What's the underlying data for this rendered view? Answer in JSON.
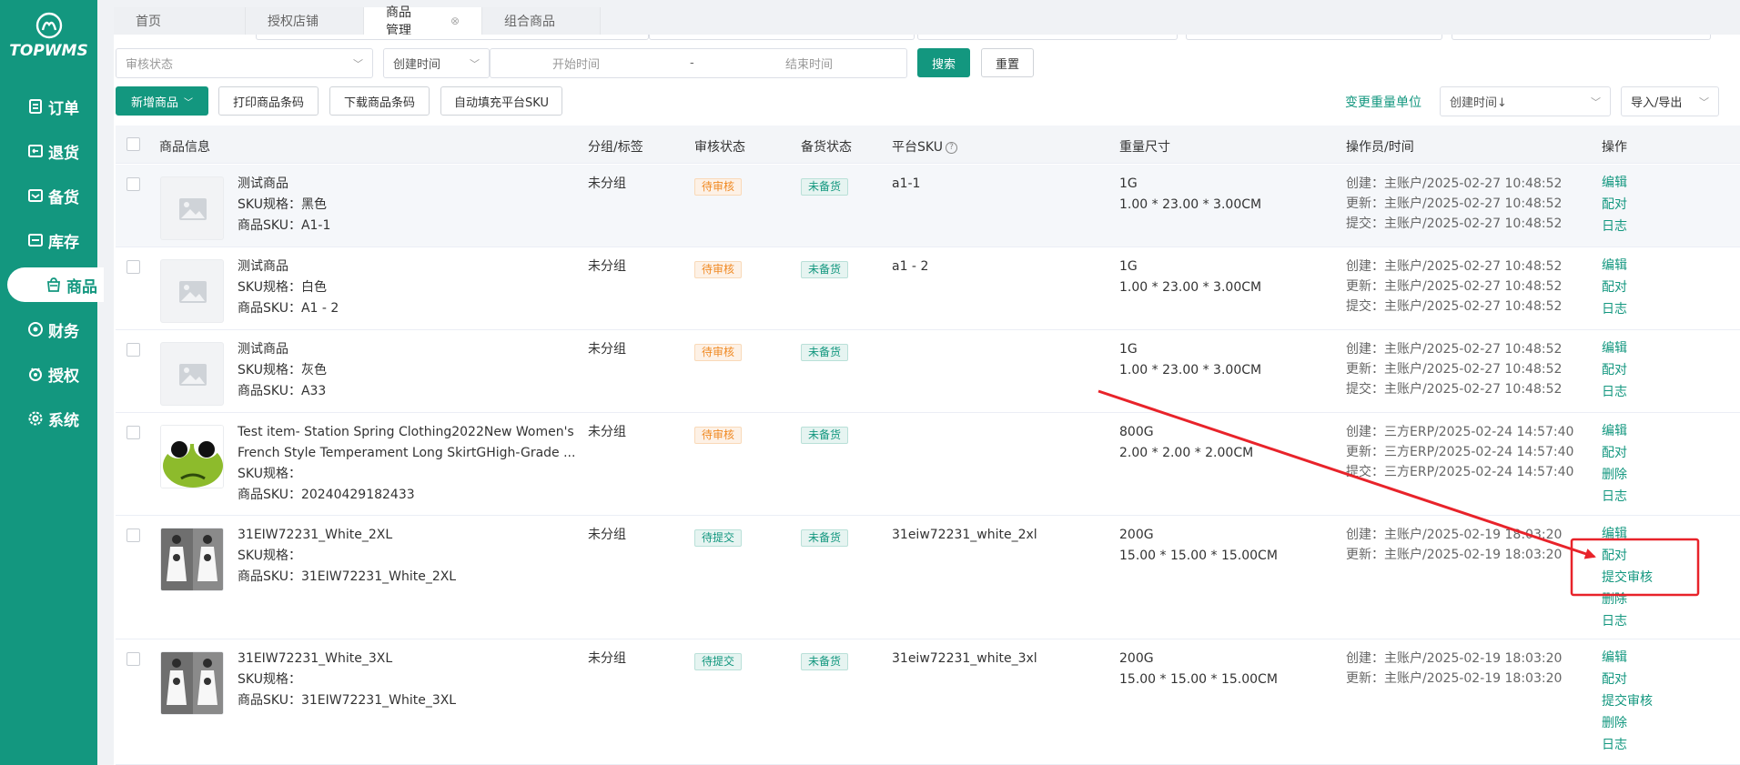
{
  "app": {
    "logo_text": "TOPWMS"
  },
  "sidebar": {
    "items": [
      {
        "label": "订单",
        "icon": "orders-icon"
      },
      {
        "label": "退货",
        "icon": "returns-icon"
      },
      {
        "label": "备货",
        "icon": "stocking-icon"
      },
      {
        "label": "库存",
        "icon": "inventory-icon"
      },
      {
        "label": "商品",
        "icon": "goods-icon",
        "active": true
      },
      {
        "label": "财务",
        "icon": "finance-icon"
      },
      {
        "label": "授权",
        "icon": "auth-icon"
      },
      {
        "label": "系统",
        "icon": "settings-icon"
      }
    ]
  },
  "tabs": [
    {
      "label": "首页"
    },
    {
      "label": "授权店铺"
    },
    {
      "label": "商品管理",
      "active": true
    },
    {
      "label": "组合商品"
    }
  ],
  "filters": {
    "review_status_placeholder": "审核状态",
    "time_type": "创建时间",
    "start_placeholder": "开始时间",
    "range_sep": "-",
    "end_placeholder": "结束时间",
    "search_label": "搜索",
    "reset_label": "重置"
  },
  "toolbar": {
    "new_product": "新增商品",
    "print_barcode": "打印商品条码",
    "download_barcode": "下载商品条码",
    "autofill_sku": "自动填充平台SKU",
    "change_weight_unit": "变更重量单位",
    "sort_select": "创建时间↓",
    "import_export": "导入/导出"
  },
  "table": {
    "headers": {
      "product_info": "商品信息",
      "group_tag": "分组/标签",
      "review_status": "审核状态",
      "stock_status": "备货状态",
      "platform_sku": "平台SKU",
      "weight_size": "重量尺寸",
      "operator_time": "操作员/时间",
      "actions": "操作"
    },
    "rows": [
      {
        "name_lines": [
          "测试商品",
          "SKU规格：黑色",
          "商品SKU：A1-1"
        ],
        "group": "未分组",
        "review": "待审核",
        "stock": "未备货",
        "platform_sku": "a1-1",
        "weight": "1G",
        "size": "1.00 * 23.00 * 3.00CM",
        "ops": [
          "创建：主账户/2025-02-27 10:48:52",
          "更新：主账户/2025-02-27 10:48:52",
          "提交：主账户/2025-02-27 10:48:52"
        ],
        "actions": [
          "编辑",
          "配对",
          "日志"
        ]
      },
      {
        "name_lines": [
          "测试商品",
          "SKU规格：白色",
          "商品SKU：A1 - 2"
        ],
        "group": "未分组",
        "review": "待审核",
        "stock": "未备货",
        "platform_sku": "a1 - 2",
        "weight": "1G",
        "size": "1.00 * 23.00 * 3.00CM",
        "ops": [
          "创建：主账户/2025-02-27 10:48:52",
          "更新：主账户/2025-02-27 10:48:52",
          "提交：主账户/2025-02-27 10:48:52"
        ],
        "actions": [
          "编辑",
          "配对",
          "日志"
        ]
      },
      {
        "name_lines": [
          "测试商品",
          "SKU规格：灰色",
          "商品SKU：A33"
        ],
        "group": "未分组",
        "review": "待审核",
        "stock": "未备货",
        "platform_sku": "",
        "weight": "1G",
        "size": "1.00 * 23.00 * 3.00CM",
        "ops": [
          "创建：主账户/2025-02-27 10:48:52",
          "更新：主账户/2025-02-27 10:48:52",
          "提交：主账户/2025-02-27 10:48:52"
        ],
        "actions": [
          "编辑",
          "配对",
          "日志"
        ]
      },
      {
        "name_lines": [
          "Test item- Station Spring Clothing2022New Women's",
          "French Style Temperament Long SkirtGHigh-Grade ...",
          "SKU规格：",
          "商品SKU：20240429182433"
        ],
        "group": "未分组",
        "review": "待审核",
        "stock": "未备货",
        "platform_sku": "",
        "weight": "800G",
        "size": "2.00 * 2.00 * 2.00CM",
        "ops": [
          "创建：三方ERP/2025-02-24 14:57:40",
          "更新：三方ERP/2025-02-24 14:57:40",
          "提交：三方ERP/2025-02-24 14:57:40"
        ],
        "actions": [
          "编辑",
          "配对",
          "删除",
          "日志"
        ]
      },
      {
        "name_lines": [
          "31EIW72231_White_2XL",
          "SKU规格：",
          "商品SKU：31EIW72231_White_2XL"
        ],
        "group": "未分组",
        "review": "待提交",
        "stock": "未备货",
        "platform_sku": "31eiw72231_white_2xl",
        "weight": "200G",
        "size": "15.00 * 15.00 * 15.00CM",
        "ops": [
          "创建：主账户/2025-02-19 18:03:20",
          "更新：主账户/2025-02-19 18:03:20"
        ],
        "actions": [
          "编辑",
          "配对",
          "提交审核",
          "删除",
          "日志"
        ]
      },
      {
        "name_lines": [
          "31EIW72231_White_3XL",
          "SKU规格：",
          "商品SKU：31EIW72231_White_3XL"
        ],
        "group": "未分组",
        "review": "待提交",
        "stock": "未备货",
        "platform_sku": "31eiw72231_white_3xl",
        "weight": "200G",
        "size": "15.00 * 15.00 * 15.00CM",
        "ops": [
          "创建：主账户/2025-02-19 18:03:20",
          "更新：主账户/2025-02-19 18:03:20"
        ],
        "actions": [
          "编辑",
          "配对",
          "提交审核",
          "删除",
          "日志"
        ]
      }
    ]
  },
  "colors": {
    "brand": "#13977f",
    "annotation": "#e8232a",
    "pending_review": "#f08a24"
  }
}
